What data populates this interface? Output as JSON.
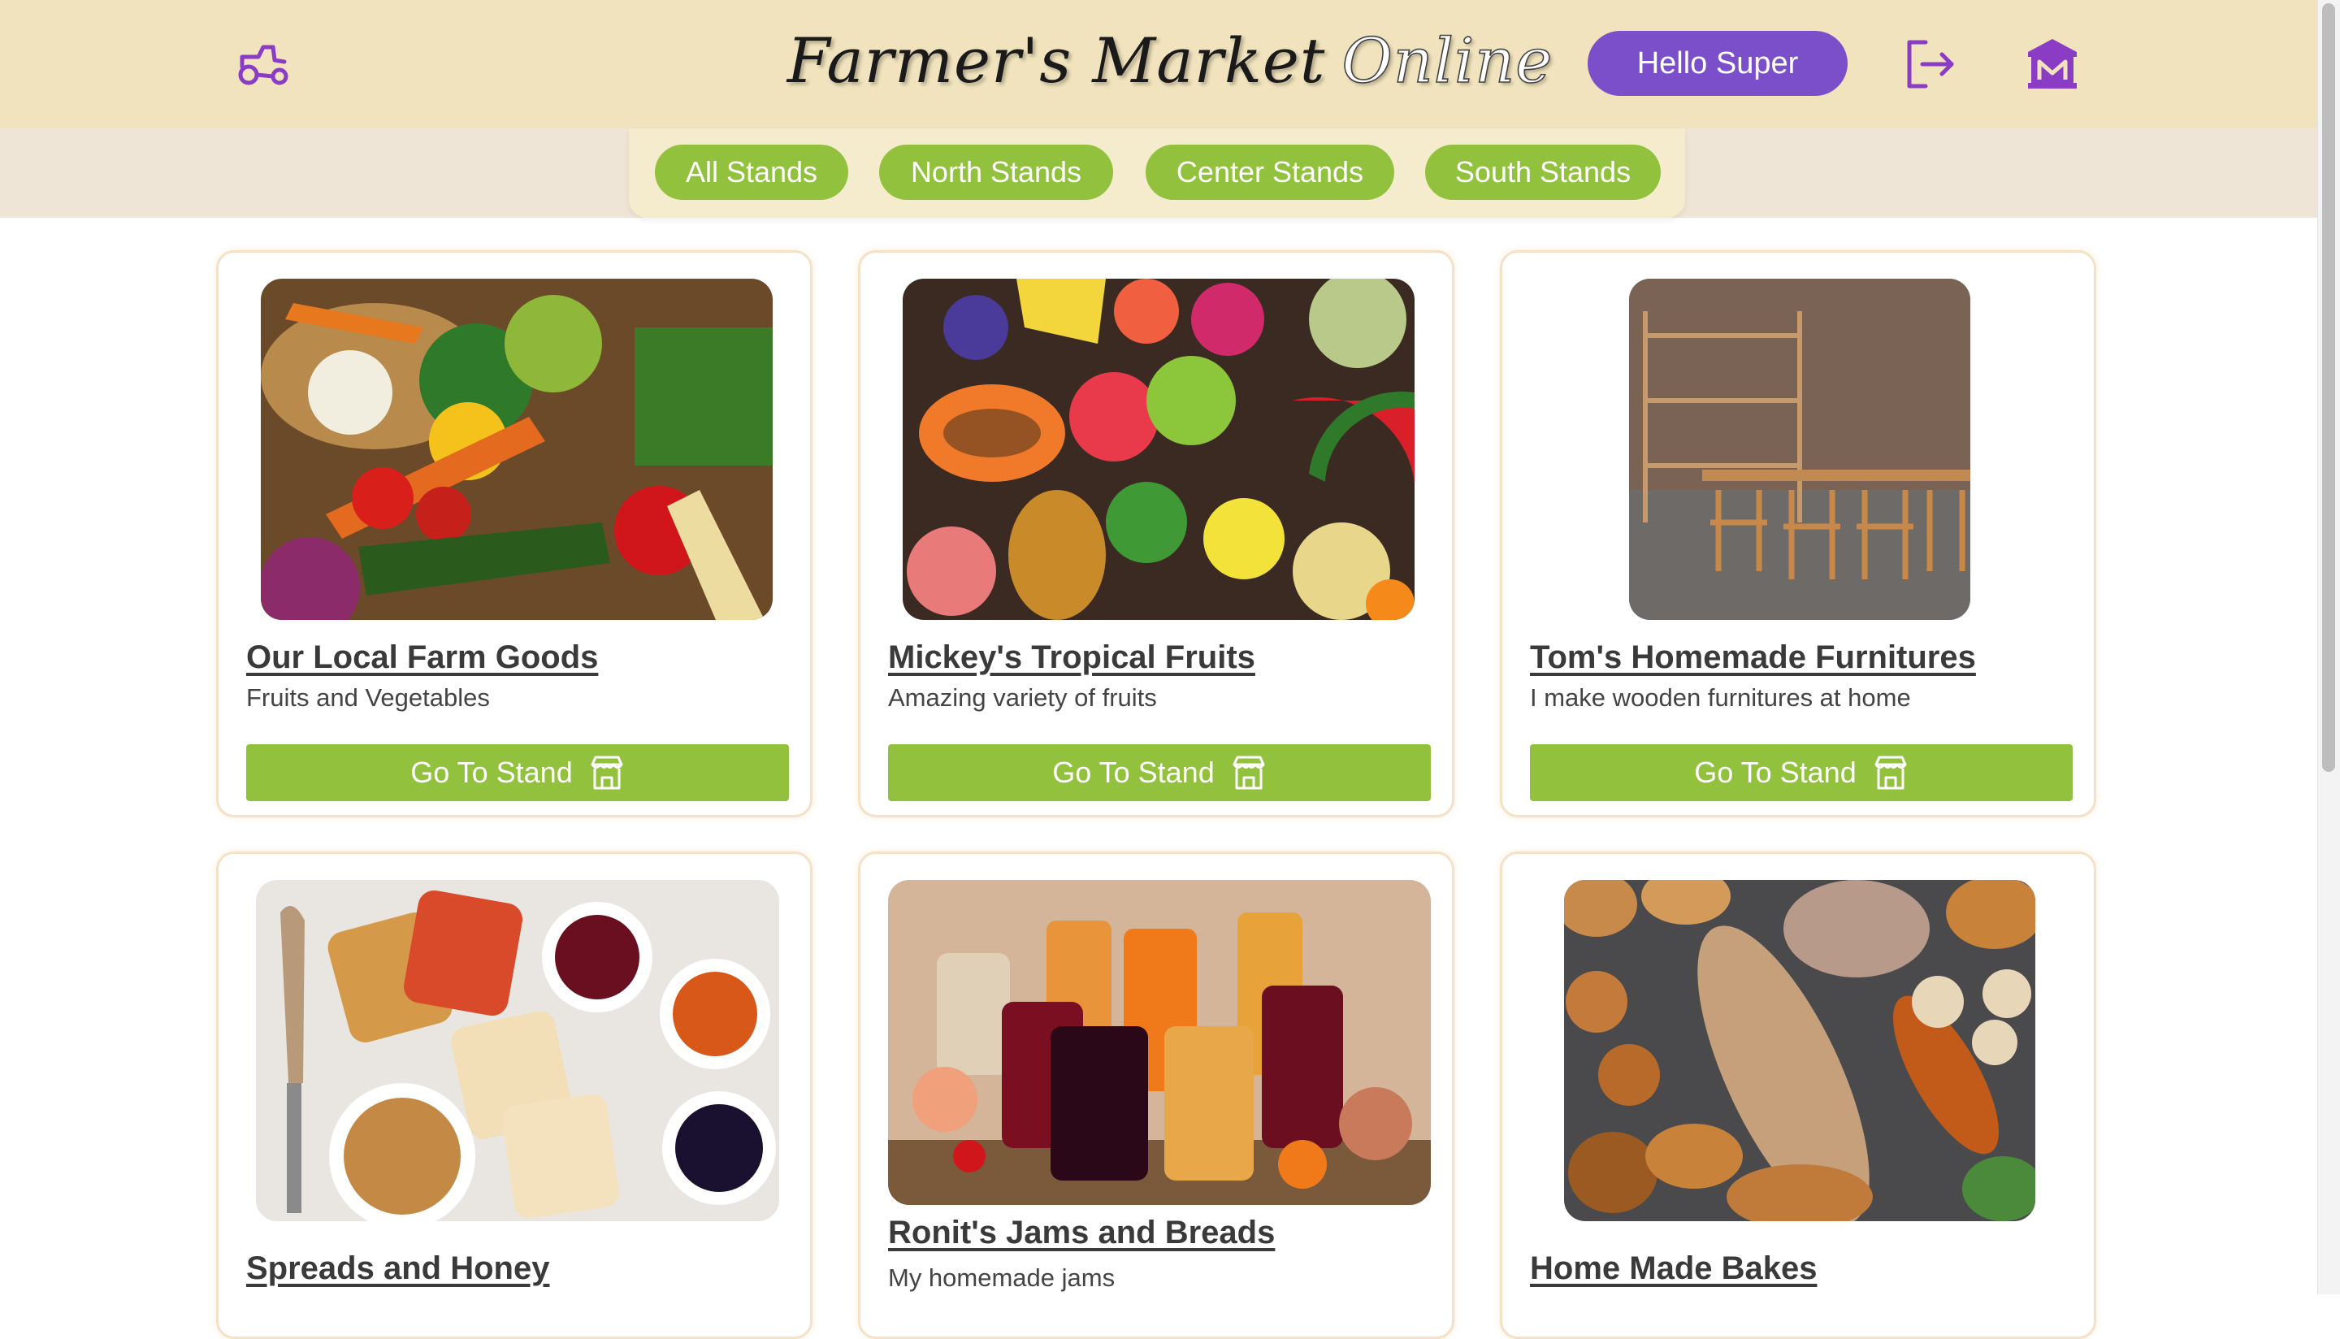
{
  "header": {
    "brand_word1": "Farmer's Market",
    "brand_word2": "Online",
    "greeting": "Hello Super",
    "logo_icon": "tractor-icon",
    "logout_icon": "logout-icon",
    "market_icon": "market-building-icon"
  },
  "nav": {
    "tabs": [
      {
        "label": "All Stands"
      },
      {
        "label": "North Stands"
      },
      {
        "label": "Center Stands"
      },
      {
        "label": "South Stands"
      }
    ]
  },
  "stands": [
    {
      "title": "Our Local Farm Goods",
      "description": "Fruits and Vegetables",
      "button": "Go To Stand",
      "image": "vegetables-photo"
    },
    {
      "title": "Mickey's Tropical Fruits",
      "description": "Amazing variety of fruits",
      "button": "Go To Stand",
      "image": "tropical-fruits-photo"
    },
    {
      "title": "Tom's Homemade Furnitures",
      "description": "I make wooden furnitures at home",
      "button": "Go To Stand",
      "image": "wooden-furniture-photo"
    },
    {
      "title": "Spreads and Honey",
      "description": "",
      "button": "",
      "image": "spreads-photo"
    },
    {
      "title": "Ronit's Jams and Breads",
      "description": "My homemade jams",
      "button": "",
      "image": "jams-photo"
    },
    {
      "title": "Home Made Bakes",
      "description": "",
      "button": "",
      "image": "bakes-photo"
    }
  ],
  "colors": {
    "header_bg": "#f1e3bd",
    "accent_green": "#92c13e",
    "accent_purple": "#7b4fc9",
    "card_border": "#f4e1c8"
  }
}
